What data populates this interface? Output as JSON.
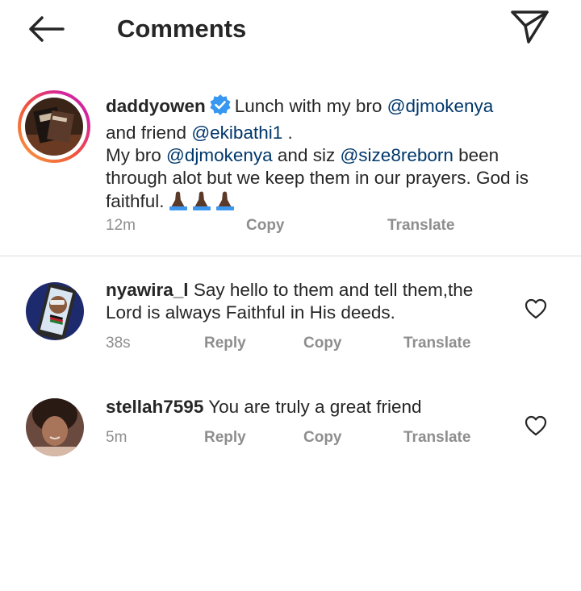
{
  "header": {
    "title": "Comments"
  },
  "caption": {
    "username": "daddyowen",
    "text_1": "Lunch with my bro ",
    "mention_1": "@djmokenya",
    "text_2": "and friend ",
    "mention_2": "@ekibathi1",
    "text_3": " .",
    "text_4": "My bro ",
    "mention_3": "@djmokenya",
    "text_5": " and siz ",
    "mention_4": "@size8reborn",
    "text_6": " been through alot but we keep them in our prayers. God is faithful.",
    "time": "12m",
    "copy_label": "Copy",
    "translate_label": "Translate"
  },
  "comments": [
    {
      "username": "nyawira_l",
      "text": "Say hello to them and tell them,the Lord is always Faithful in His deeds.",
      "time": "38s",
      "reply_label": "Reply",
      "copy_label": "Copy",
      "translate_label": "Translate"
    },
    {
      "username": "stellah7595",
      "text": "You are truly a great friend",
      "time": "5m",
      "reply_label": "Reply",
      "copy_label": "Copy",
      "translate_label": "Translate"
    }
  ],
  "colors": {
    "mention": "#00376b",
    "meta": "#8e8e8e",
    "verified": "#3897f0"
  }
}
